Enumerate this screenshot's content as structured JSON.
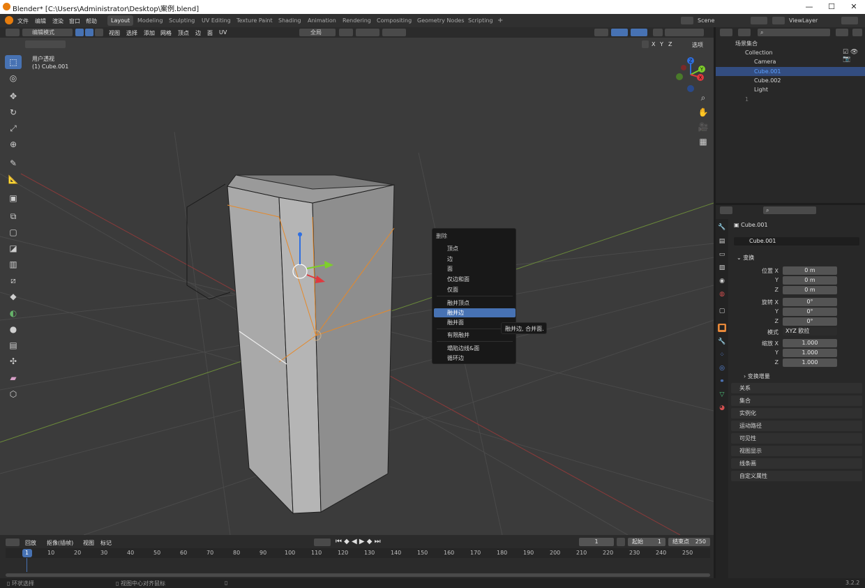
{
  "window": {
    "title": "Blender* [C:\\Users\\Administrator\\Desktop\\案例.blend]"
  },
  "menubar": [
    "文件",
    "编辑",
    "渲染",
    "窗口",
    "帮助"
  ],
  "workspaces": [
    "Layout",
    "Modeling",
    "Sculpting",
    "UV Editing",
    "Texture Paint",
    "Shading",
    "Animation",
    "Rendering",
    "Compositing",
    "Geometry Nodes",
    "Scripting",
    "+"
  ],
  "scene": {
    "label": "Scene",
    "viewlayer": "ViewLayer"
  },
  "viewport_header": {
    "mode": "编辑模式",
    "menus": [
      "视图",
      "选择",
      "添加",
      "网格",
      "顶点",
      "边",
      "面",
      "UV"
    ],
    "transform_orient": "全局",
    "options": "选项",
    "axes": [
      "X",
      "Y",
      "Z"
    ]
  },
  "viewport_info": {
    "view_name": "用户透视",
    "object_name": "(1) Cube.001"
  },
  "gizmo_axes": [
    "Z",
    "Y",
    "X"
  ],
  "context_menu": {
    "title": "删除",
    "items": [
      "顶点",
      "边",
      "面",
      "仅边和面",
      "仅面",
      "融并顶点",
      "融并边",
      "融并面",
      "有限融并",
      "塌陷边线&面",
      "循环边"
    ],
    "highlighted": "融并边"
  },
  "tooltip": "融并边, 合并面.",
  "outliner": {
    "root": "场景集合",
    "collection": "Collection",
    "items": [
      "Camera",
      "Cube.001",
      "Cube.002",
      "Light"
    ],
    "selected": "Cube.001",
    "extra": "1"
  },
  "properties": {
    "object_name": "Cube.001",
    "data_name": "Cube.001",
    "section": "变换",
    "location_label": "位置 X",
    "rotation_label": "旋转 X",
    "scale_label": "缩放 X",
    "axis_labels": [
      "Y",
      "Z"
    ],
    "location": [
      "0 m",
      "0 m",
      "0 m"
    ],
    "rotation": [
      "0°",
      "0°",
      "0°"
    ],
    "mode_label": "模式",
    "mode_value": "XYZ 欧拉",
    "scale": [
      "1.000",
      "1.000",
      "1.000"
    ],
    "delta": "变换增量",
    "panels": [
      "关系",
      "集合",
      "实例化",
      "运动路径",
      "可见性",
      "视图显示",
      "线条画",
      "自定义属性"
    ]
  },
  "timeline": {
    "menus": [
      "回放",
      "抠像(插帧)",
      "视图",
      "标记"
    ],
    "current_frame": "1",
    "start_label": "起始",
    "start": "1",
    "end_label": "结束点",
    "end": "250",
    "ticks": [
      "1",
      "10",
      "20",
      "30",
      "40",
      "50",
      "60",
      "70",
      "80",
      "90",
      "100",
      "110",
      "120",
      "130",
      "140",
      "150",
      "160",
      "170",
      "180",
      "190",
      "200",
      "210",
      "220",
      "230",
      "240",
      "250"
    ]
  },
  "statusbar": {
    "left": "环状选择",
    "mid": "视图中心对齐鼠标",
    "version": "3.2.2"
  },
  "colors": {
    "accent": "#4772b3",
    "edit_edge": "#e5892a",
    "bg": "#3b3b3b"
  }
}
